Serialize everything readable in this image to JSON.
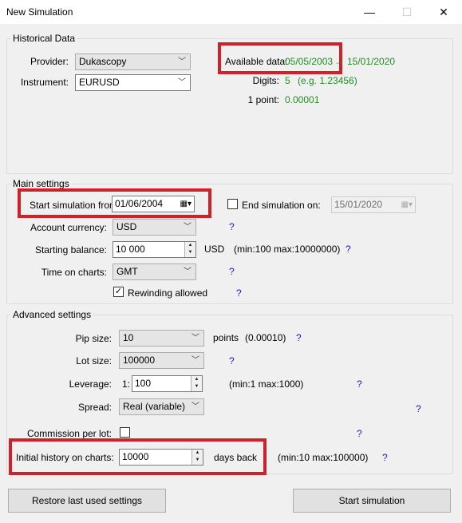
{
  "window": {
    "title": "New Simulation",
    "minimize_glyph": "—",
    "maximize_glyph": "☐",
    "close_glyph": "✕"
  },
  "historical": {
    "legend": "Historical Data",
    "provider_label": "Provider:",
    "provider_value": "Dukascopy",
    "instrument_label": "Instrument:",
    "instrument_value": "EURUSD",
    "available_label": "Available data:",
    "available_from": "05/05/2003",
    "available_arrow": "→",
    "available_to": "15/01/2020",
    "digits_label": "Digits:",
    "digits_value": "5",
    "digits_example": "(e.g. 1.23456)",
    "point_label": "1 point:",
    "point_value": "0.00001"
  },
  "main": {
    "legend": "Main settings",
    "start_label": "Start simulation from:",
    "start_value": "01/06/2004",
    "end_label": "End simulation on:",
    "end_value": "15/01/2020",
    "end_checked": false,
    "currency_label": "Account currency:",
    "currency_value": "USD",
    "balance_label": "Starting balance:",
    "balance_value": "10 000",
    "balance_unit": "USD",
    "balance_range": "(min:100  max:10000000)",
    "time_label": "Time on charts:",
    "time_value": "GMT",
    "rewind_label": "Rewinding allowed",
    "rewind_checked": true,
    "help": "?"
  },
  "advanced": {
    "legend": "Advanced settings",
    "pip_label": "Pip size:",
    "pip_value": "10",
    "pip_unit": "points",
    "pip_points": "(0.00010)",
    "lot_label": "Lot size:",
    "lot_value": "100000",
    "leverage_label": "Leverage:",
    "leverage_prefix": "1:",
    "leverage_value": "100",
    "leverage_range": "(min:1  max:1000)",
    "spread_label": "Spread:",
    "spread_value": "Real (variable)",
    "commission_label": "Commission per lot:",
    "commission_checked": false,
    "history_label": "Initial history on charts:",
    "history_value": "10000",
    "history_unit": "days back",
    "history_range": "(min:10  max:100000)",
    "help": "?"
  },
  "buttons": {
    "restore": "Restore last used settings",
    "start": "Start simulation"
  },
  "colors": {
    "highlight": "#d0202a",
    "green_text": "#228b22",
    "help_blue": "#1a1acd"
  }
}
